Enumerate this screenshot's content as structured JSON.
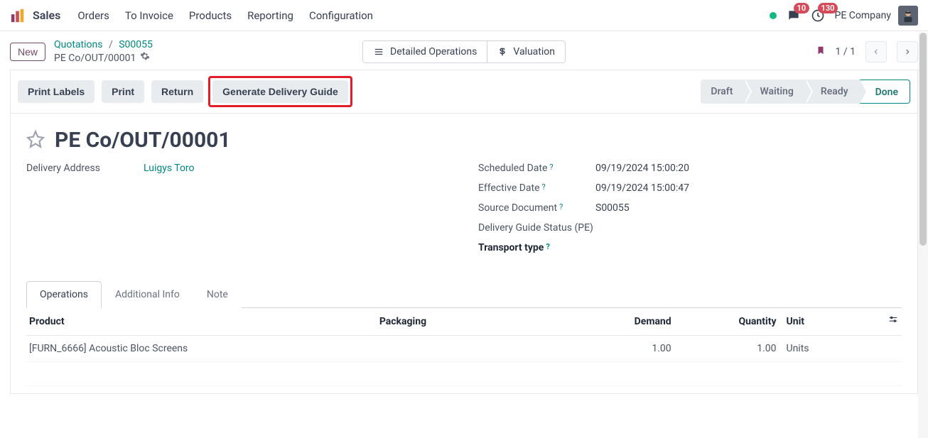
{
  "navbar": {
    "brand": "Sales",
    "items": [
      "Orders",
      "To Invoice",
      "Products",
      "Reporting",
      "Configuration"
    ],
    "chat_badge": "10",
    "activity_badge": "130",
    "company": "PE Company"
  },
  "breadcrumb": {
    "new_label": "New",
    "link1": "Quotations",
    "link2": "S00055",
    "current": "PE Co/OUT/00001"
  },
  "center_buttons": {
    "detailed_ops": "Detailed Operations",
    "valuation": "Valuation"
  },
  "pager": {
    "text": "1 / 1"
  },
  "actions": {
    "print_labels": "Print Labels",
    "print": "Print",
    "return": "Return",
    "generate_guide": "Generate Delivery Guide"
  },
  "status": {
    "stages": [
      "Draft",
      "Waiting",
      "Ready",
      "Done"
    ],
    "active_index": 3
  },
  "record": {
    "title": "PE Co/OUT/00001",
    "delivery_address_label": "Delivery Address",
    "delivery_address_value": "Luigys Toro",
    "scheduled_date_label": "Scheduled Date",
    "scheduled_date_value": "09/19/2024 15:00:20",
    "effective_date_label": "Effective Date",
    "effective_date_value": "09/19/2024 15:00:47",
    "source_doc_label": "Source Document",
    "source_doc_value": "S00055",
    "guide_status_label": "Delivery Guide Status (PE)",
    "transport_type_label": "Transport type"
  },
  "tabs": {
    "operations": "Operations",
    "additional": "Additional Info",
    "note": "Note"
  },
  "table": {
    "headers": {
      "product": "Product",
      "packaging": "Packaging",
      "demand": "Demand",
      "quantity": "Quantity",
      "unit": "Unit"
    },
    "rows": [
      {
        "product": "[FURN_6666] Acoustic Bloc Screens",
        "packaging": "",
        "demand": "1.00",
        "quantity": "1.00",
        "unit": "Units"
      }
    ]
  }
}
